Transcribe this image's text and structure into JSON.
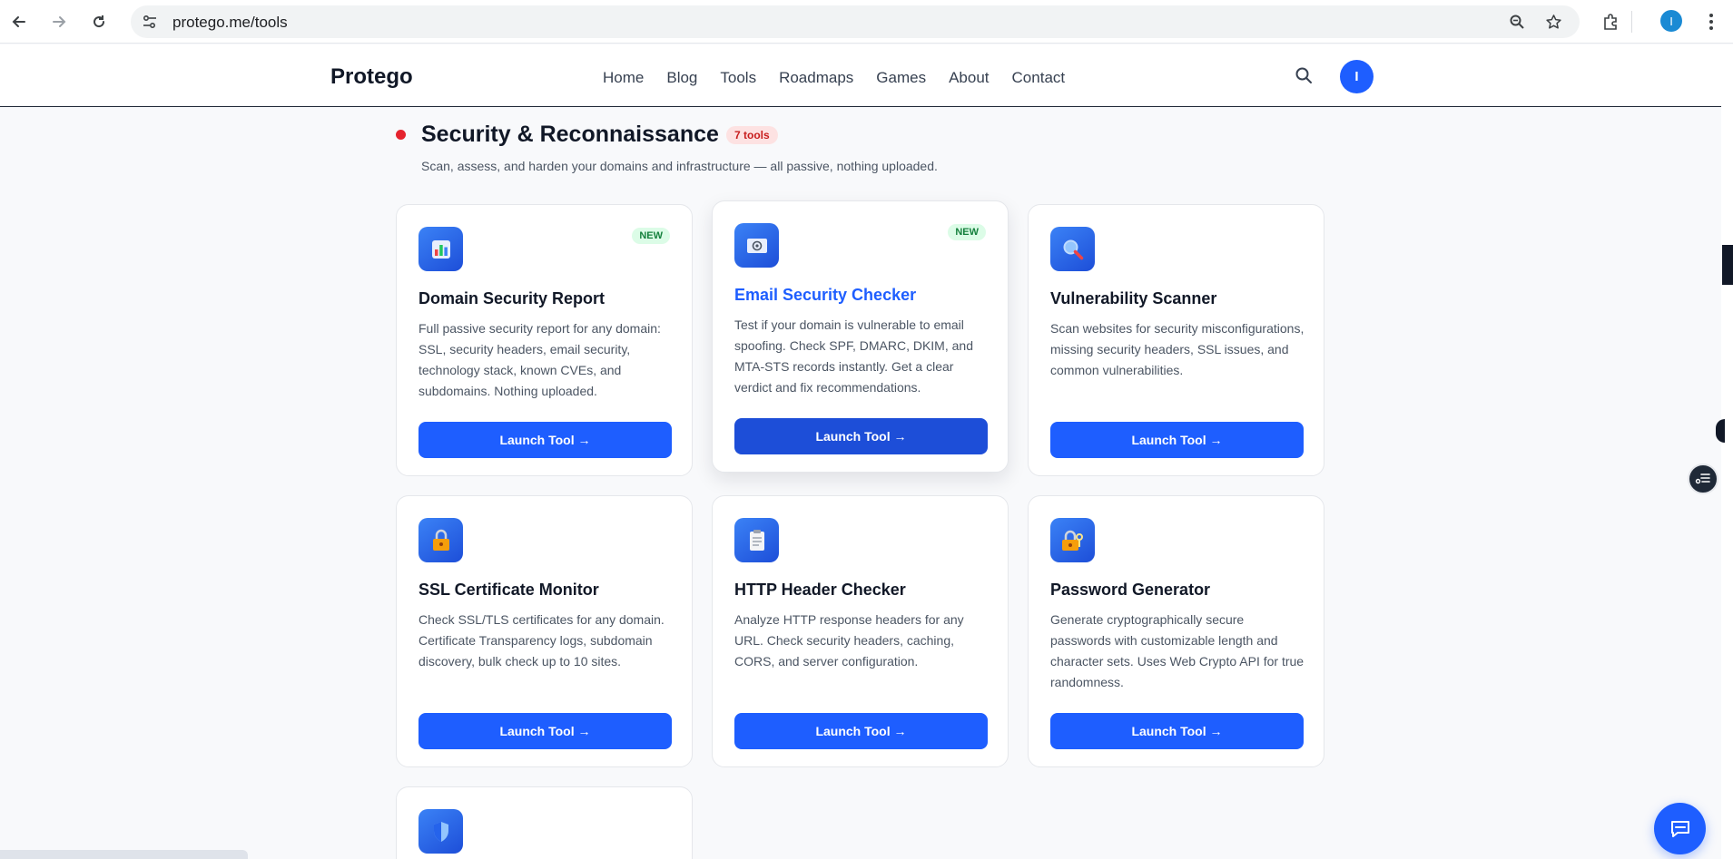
{
  "browser": {
    "url": "protego.me/tools",
    "profile_initial": "I"
  },
  "site": {
    "brand": "Protego",
    "nav": [
      "Home",
      "Blog",
      "Tools",
      "Roadmaps",
      "Games",
      "About",
      "Contact"
    ],
    "avatar_initial": "I"
  },
  "section": {
    "title": "Security & Reconnaissance",
    "count_badge": "7 tools",
    "description": "Scan, assess, and harden your domains and infrastructure — all passive, nothing uploaded.",
    "accent_color": "#e5242e"
  },
  "cards": [
    {
      "icon": "bar-chart-icon",
      "badge": "NEW",
      "title": "Domain Security Report",
      "description": "Full passive security report for any domain: SSL, security headers, email security, technology stack, known CVEs, and subdomains. Nothing uploaded.",
      "button": "Launch Tool →"
    },
    {
      "icon": "email-icon",
      "badge": "NEW",
      "title": "Email Security Checker",
      "description": "Test if your domain is vulnerable to email spoofing. Check SPF, DMARC, DKIM, and MTA-STS records instantly. Get a clear verdict and fix recommendations.",
      "button": "Launch Tool →"
    },
    {
      "icon": "magnifier-icon",
      "title": "Vulnerability Scanner",
      "description": "Scan websites for security misconfigurations, missing security headers, SSL issues, and common vulnerabilities.",
      "button": "Launch Tool →"
    },
    {
      "icon": "lock-icon",
      "title": "SSL Certificate Monitor",
      "description": "Check SSL/TLS certificates for any domain. Certificate Transparency logs, subdomain discovery, bulk check up to 10 sites.",
      "button": "Launch Tool →"
    },
    {
      "icon": "document-icon",
      "title": "HTTP Header Checker",
      "description": "Analyze HTTP response headers for any URL. Check security headers, caching, CORS, and server configuration.",
      "button": "Launch Tool →"
    },
    {
      "icon": "key-lock-icon",
      "title": "Password Generator",
      "description": "Generate cryptographically secure passwords with customizable length and character sets. Uses Web Crypto API for true randomness.",
      "button": "Launch Tool →"
    },
    {
      "icon": "shield-icon"
    }
  ],
  "colors": {
    "primary": "#1e5eff",
    "new_badge_bg": "#dcfce7",
    "new_badge_text": "#15803d"
  }
}
